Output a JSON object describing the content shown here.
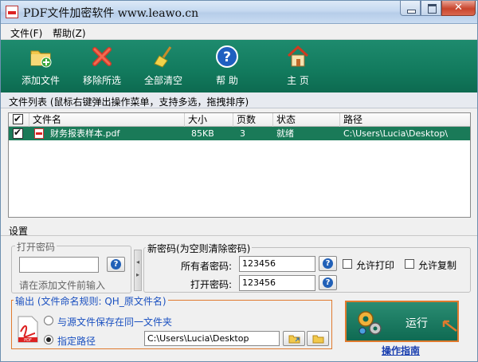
{
  "window": {
    "title": "PDF文件加密软件 www.leawo.cn"
  },
  "menu": {
    "file": "文件(F)",
    "help": "帮助(Z)"
  },
  "toolbar": {
    "add": "添加文件",
    "remove": "移除所选",
    "clear": "全部清空",
    "help": "帮 助",
    "home": "主 页"
  },
  "file_list": {
    "caption": "文件列表   (鼠标右键弹出操作菜单，支持多选，拖拽排序)",
    "columns": [
      "文件名",
      "大小",
      "页数",
      "状态",
      "路径"
    ],
    "rows": [
      {
        "checked": true,
        "name": "财务报表样本.pdf",
        "size": "85KB",
        "pages": "3",
        "status": "就绪",
        "path": "C:\\Users\\Lucia\\Desktop\\"
      }
    ]
  },
  "settings": {
    "caption": "设置",
    "open_pw_group": "打开密码",
    "open_pw_value": "",
    "open_pw_hint": "请在添加文件前输入",
    "new_pw_group": "新密码(为空则清除密码)",
    "owner_label": "所有者密码:",
    "owner_value": "123456",
    "open_label": "打开密码:",
    "open_value": "123456",
    "allow_print": "允许打印",
    "allow_copy": "允许复制",
    "output_group": "输出 (文件命名规则: QH_原文件名)",
    "same_folder": "与源文件保存在同一文件夹",
    "specified": "指定路径",
    "output_path": "C:\\Users\\Lucia\\Desktop"
  },
  "run": {
    "label": "运行",
    "guide": "操作指南"
  },
  "colors": {
    "accent": "#127a5d",
    "highlight_row": "#1a7a58",
    "orange": "#e07a2e"
  }
}
